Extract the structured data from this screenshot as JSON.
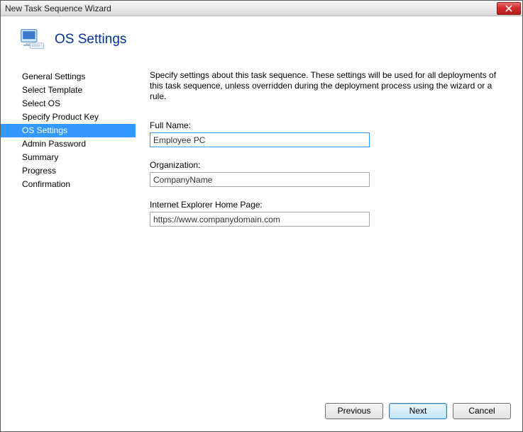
{
  "window": {
    "title": "New Task Sequence Wizard"
  },
  "header": {
    "title": "OS Settings"
  },
  "sidebar": {
    "items": [
      {
        "label": "General Settings"
      },
      {
        "label": "Select Template"
      },
      {
        "label": "Select OS"
      },
      {
        "label": "Specify Product Key"
      },
      {
        "label": "OS Settings"
      },
      {
        "label": "Admin Password"
      },
      {
        "label": "Summary"
      },
      {
        "label": "Progress"
      },
      {
        "label": "Confirmation"
      }
    ],
    "selected_index": 4
  },
  "main": {
    "description": "Specify settings about this task sequence.  These settings will be used for all deployments of this task sequence, unless overridden during the deployment process using the wizard or a rule.",
    "fields": {
      "full_name": {
        "label": "Full Name:",
        "value": "Employee PC"
      },
      "organization": {
        "label": "Organization:",
        "value": "CompanyName"
      },
      "ie_home": {
        "label": "Internet Explorer Home Page:",
        "value": "https://www.companydomain.com"
      }
    }
  },
  "footer": {
    "previous": "Previous",
    "next": "Next",
    "cancel": "Cancel"
  }
}
